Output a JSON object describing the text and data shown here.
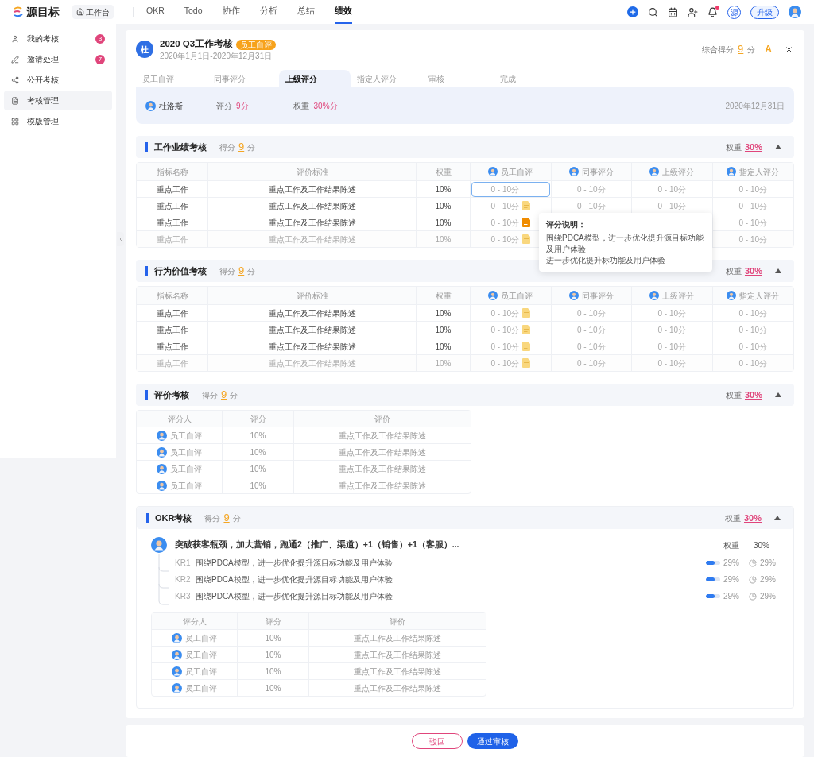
{
  "nav": {
    "logo": "源目标",
    "workbench": "工作台",
    "items": [
      {
        "label": "OKR",
        "selected": false
      },
      {
        "label": "Todo",
        "selected": false
      },
      {
        "label": "协作",
        "selected": false
      },
      {
        "label": "分析",
        "selected": false
      },
      {
        "label": "总结",
        "selected": false
      },
      {
        "label": "绩效",
        "selected": true
      }
    ],
    "notification": true,
    "org_badge": "源",
    "upgrade": "升级"
  },
  "sidebar": {
    "items": [
      {
        "label": "我的考核",
        "badge": "3",
        "selected": false
      },
      {
        "label": "邀请处理",
        "badge": "7",
        "selected": false
      },
      {
        "label": "公开考核",
        "selected": false
      },
      {
        "label": "考核管理",
        "selected": true
      },
      {
        "label": "模版管理",
        "selected": false
      }
    ]
  },
  "review": {
    "avatar_text": "杜",
    "title": "2020 Q3工作考核",
    "tag": "员工自评",
    "period": "2020年1月1日-2020年12月31日",
    "total_label": "综合得分",
    "total": "9",
    "total_unit": "分",
    "grade": "A"
  },
  "tabs": [
    {
      "label": "员工自评",
      "selected": false
    },
    {
      "label": "同事评分",
      "selected": false
    },
    {
      "label": "上级评分",
      "selected": true
    },
    {
      "label": "指定人评分",
      "selected": false
    },
    {
      "label": "审核",
      "selected": false
    },
    {
      "label": "完成",
      "selected": false
    }
  ],
  "info": {
    "name": "杜洛斯",
    "score_label": "评分",
    "score": "9分",
    "weight_label": "权重",
    "weight": "30%分",
    "date": "2020年12月31日"
  },
  "sections": [
    {
      "kind": "indicators",
      "title": "工作业绩考核",
      "score_label": "得分",
      "score": "9",
      "score_unit": "分",
      "weight_label": "权重",
      "weight": "30%",
      "expanded": true,
      "columns": [
        "指标名称",
        "评价标准",
        "权重",
        "员工自评",
        "同事评分",
        "上级评分",
        "指定人评分"
      ],
      "rows": [
        {
          "name": "重点工作",
          "criteria": "重点工作及工作结果陈述",
          "weight": "10%",
          "scores": {
            "self": "0 - 10分",
            "peer": "0 - 10分",
            "manager": "0 - 10分",
            "assignee": "0 - 10分"
          },
          "focused": true,
          "note": false,
          "dimmed": false
        },
        {
          "name": "重点工作",
          "criteria": "重点工作及工作结果陈述",
          "weight": "10%",
          "scores": {
            "self": "0 - 10分",
            "peer": "0 - 10分",
            "manager": "0 - 10分",
            "assignee": "0 - 10分"
          },
          "focused": false,
          "note": true,
          "note_active": false,
          "dimmed": false
        },
        {
          "name": "重点工作",
          "criteria": "重点工作及工作结果陈述",
          "weight": "10%",
          "scores": {
            "self": "0 - 10分",
            "assignee": "0 - 10分"
          },
          "focused": false,
          "note": true,
          "note_active": true,
          "dimmed": false
        },
        {
          "name": "重点工作",
          "criteria": "重点工作及工作结果陈述",
          "weight": "10%",
          "scores": {
            "self": "0 - 10分",
            "assignee": "0 - 10分"
          },
          "focused": false,
          "note": true,
          "note_active": false,
          "dimmed": true
        }
      ],
      "tooltip": {
        "title": "评分说明：",
        "lines": [
          "围绕PDCA模型，进一步优化提升源目标功能及用户体验",
          "进一步优化提升标功能及用户体验"
        ]
      }
    },
    {
      "kind": "indicators",
      "title": "行为价值考核",
      "score_label": "得分",
      "score": "9",
      "score_unit": "分",
      "weight_label": "权重",
      "weight": "30%",
      "expanded": true,
      "columns": [
        "指标名称",
        "评价标准",
        "权重",
        "员工自评",
        "同事评分",
        "上级评分",
        "指定人评分"
      ],
      "rows": [
        {
          "name": "重点工作",
          "criteria": "重点工作及工作结果陈述",
          "weight": "10%",
          "scores": [
            "0 - 10分",
            "0 - 10分",
            "0 - 10分",
            "0 - 10分"
          ],
          "focused": false,
          "note": true,
          "note_active": false,
          "dimmed": false
        },
        {
          "name": "重点工作",
          "criteria": "重点工作及工作结果陈述",
          "weight": "10%",
          "scores": [
            "0 - 10分",
            "0 - 10分",
            "0 - 10分",
            "0 - 10分"
          ],
          "focused": false,
          "note": true,
          "note_active": false,
          "dimmed": false
        },
        {
          "name": "重点工作",
          "criteria": "重点工作及工作结果陈述",
          "weight": "10%",
          "scores": [
            "0 - 10分",
            "0 - 10分",
            "0 - 10分",
            "0 - 10分"
          ],
          "focused": false,
          "note": true,
          "note_active": false,
          "dimmed": false
        },
        {
          "name": "重点工作",
          "criteria": "重点工作及工作结果陈述",
          "weight": "10%",
          "scores": [
            "0 - 10分",
            "0 - 10分",
            "0 - 10分",
            "0 - 10分"
          ],
          "focused": false,
          "note": true,
          "note_active": false,
          "dimmed": true
        }
      ]
    },
    {
      "kind": "reviews",
      "title": "评价考核",
      "score_label": "得分",
      "score": "9",
      "score_unit": "分",
      "weight_label": "权重",
      "weight": "30%",
      "expanded": true,
      "columns": [
        "评分人",
        "评分",
        "评价"
      ],
      "rows": [
        {
          "reviewer": "员工自评",
          "score": "10%",
          "comment": "重点工作及工作结果陈述"
        },
        {
          "reviewer": "员工自评",
          "score": "10%",
          "comment": "重点工作及工作结果陈述"
        },
        {
          "reviewer": "员工自评",
          "score": "10%",
          "comment": "重点工作及工作结果陈述"
        },
        {
          "reviewer": "员工自评",
          "score": "10%",
          "comment": "重点工作及工作结果陈述"
        }
      ]
    },
    {
      "kind": "okr",
      "title": "OKR考核",
      "score_label": "得分",
      "score": "9",
      "score_unit": "分",
      "weight_label": "权重",
      "weight": "30%",
      "expanded": true,
      "objective": {
        "text": "突破获客瓶颈，加大营销，跑通2（推广、渠道）+1（销售）+1（客服）...",
        "weight_label": "权重",
        "weight": "30%"
      },
      "key_results": [
        {
          "code": "KR1",
          "text": "围绕PDCA模型，进一步优化提升源目标功能及用户体验",
          "level": 0.6,
          "progress": "29%",
          "time": "29%"
        },
        {
          "code": "KR2",
          "text": "围绕PDCA模型，进一步优化提升源目标功能及用户体验",
          "level": 0.6,
          "progress": "29%",
          "time": "29%"
        },
        {
          "code": "KR3",
          "text": "围绕PDCA模型，进一步优化提升源目标功能及用户体验",
          "level": 0.6,
          "progress": "29%",
          "time": "29%"
        }
      ],
      "columns": [
        "评分人",
        "评分",
        "评价"
      ],
      "rows": [
        {
          "reviewer": "员工自评",
          "score": "10%",
          "comment": "重点工作及工作结果陈述"
        },
        {
          "reviewer": "员工自评",
          "score": "10%",
          "comment": "重点工作及工作结果陈述"
        },
        {
          "reviewer": "员工自评",
          "score": "10%",
          "comment": "重点工作及工作结果陈述"
        },
        {
          "reviewer": "员工自评",
          "score": "10%",
          "comment": "重点工作及工作结果陈述"
        }
      ]
    }
  ],
  "footer": {
    "reject": "驳回",
    "approve": "通过审核"
  }
}
